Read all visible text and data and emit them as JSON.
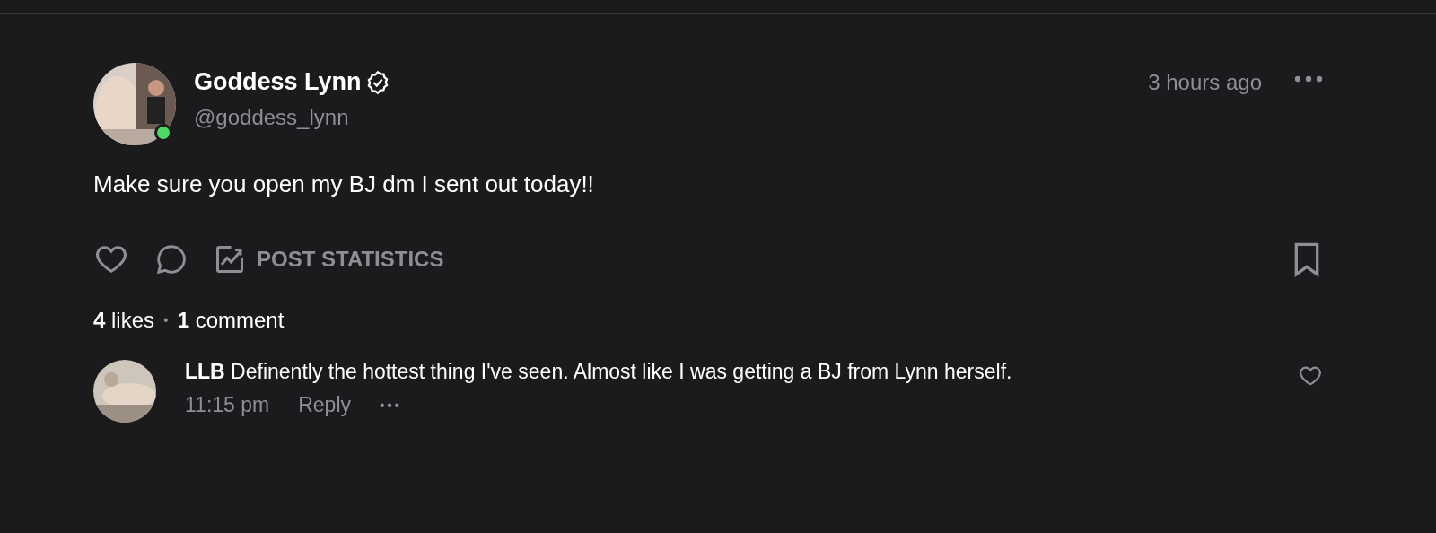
{
  "post": {
    "author": {
      "name": "Goddess Lynn",
      "verified": true,
      "handle": "@goddess_lynn",
      "online": true
    },
    "time": "3 hours ago",
    "text": "Make sure you open my BJ dm I sent out today!!",
    "actions": {
      "liked": false,
      "bookmarked": false,
      "statistics_label": "POST STATISTICS"
    },
    "stats": {
      "likes_count": "4",
      "likes_label": "likes",
      "separator": "•",
      "comments_count": "1",
      "comments_label": "comment"
    }
  },
  "comments": [
    {
      "author": "LLB",
      "text": "Definently the hottest thing I've seen. Almost like I was getting a BJ from Lynn herself.",
      "time": "11:15 pm",
      "reply_label": "Reply",
      "liked": false
    }
  ]
}
